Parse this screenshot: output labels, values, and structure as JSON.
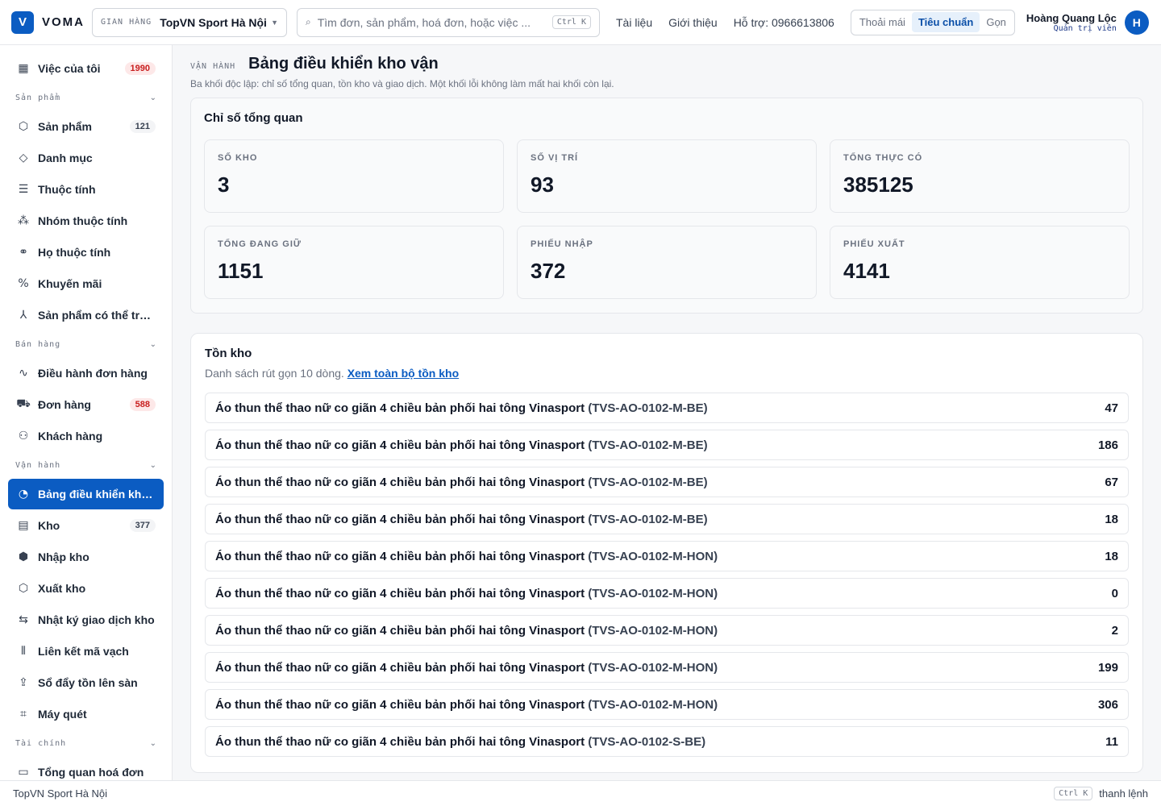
{
  "brand": {
    "logo_letter": "V",
    "name": "VOMA",
    "color": "#0b5cc2"
  },
  "store": {
    "prefix": "GIAN HÀNG",
    "name": "TopVN Sport Hà Nội"
  },
  "search": {
    "placeholder": "Tìm đơn, sản phẩm, hoá đơn, hoặc việc ...",
    "shortcut": "Ctrl K"
  },
  "top_links": [
    "Tài liệu",
    "Giới thiệu",
    "Hỗ trợ: 0966613806"
  ],
  "density": {
    "options": [
      "Thoải mái",
      "Tiêu chuẩn",
      "Gọn"
    ],
    "selected": "Tiêu chuẩn"
  },
  "user": {
    "name": "Hoàng Quang Lộc",
    "role": "Quản trị viên",
    "initial": "H"
  },
  "sidebar": {
    "top_item": {
      "label": "Việc của tôi",
      "badge": "1990",
      "icon": "grid-icon"
    },
    "sections": [
      {
        "label": "Sản phẩm",
        "items": [
          {
            "label": "Sản phẩm",
            "badge": "121",
            "icon": "box-icon"
          },
          {
            "label": "Danh mục",
            "icon": "tag-icon"
          },
          {
            "label": "Thuộc tính",
            "icon": "list-icon"
          },
          {
            "label": "Nhóm thuộc tính",
            "icon": "group-icon"
          },
          {
            "label": "Họ thuộc tính",
            "icon": "tree-icon"
          },
          {
            "label": "Khuyến mãi",
            "icon": "percent-icon"
          },
          {
            "label": "Sản phẩm có thể trùng",
            "icon": "merge-icon"
          }
        ]
      },
      {
        "label": "Bán hàng",
        "items": [
          {
            "label": "Điều hành đơn hàng",
            "icon": "activity-icon"
          },
          {
            "label": "Đơn hàng",
            "badge": "588",
            "badge_red": true,
            "icon": "cart-icon"
          },
          {
            "label": "Khách hàng",
            "icon": "users-icon"
          }
        ]
      },
      {
        "label": "Vận hành",
        "items": [
          {
            "label": "Bảng điều khiển kho vận",
            "active": true,
            "icon": "gauge-icon"
          },
          {
            "label": "Kho",
            "badge": "377",
            "icon": "warehouse-icon"
          },
          {
            "label": "Nhập kho",
            "icon": "box-in-icon"
          },
          {
            "label": "Xuất kho",
            "icon": "box-out-icon"
          },
          {
            "label": "Nhật ký giao dịch kho",
            "icon": "swap-icon"
          },
          {
            "label": "Liên kết mã vạch",
            "icon": "barcode-icon"
          },
          {
            "label": "Sổ đẩy tồn lên sàn",
            "icon": "upload-icon"
          },
          {
            "label": "Máy quét",
            "icon": "scanner-icon"
          }
        ]
      },
      {
        "label": "Tài chính",
        "items": [
          {
            "label": "Tổng quan hoá đơn",
            "icon": "invoice-icon"
          }
        ]
      }
    ]
  },
  "page": {
    "eyebrow": "VẬN HÀNH",
    "title": "Bảng điều khiển kho vận",
    "subtitle": "Ba khối độc lập: chỉ số tổng quan, tồn kho và giao dịch. Một khối lỗi không làm mất hai khối còn lại."
  },
  "kpi": {
    "title": "Chỉ số tổng quan",
    "items": [
      {
        "label": "SỐ KHO",
        "value": "3"
      },
      {
        "label": "SỐ VỊ TRÍ",
        "value": "93"
      },
      {
        "label": "TỔNG THỰC CÓ",
        "value": "385125"
      },
      {
        "label": "TỔNG ĐANG GIỮ",
        "value": "1151"
      },
      {
        "label": "PHIẾU NHẬP",
        "value": "372"
      },
      {
        "label": "PHIẾU XUẤT",
        "value": "4141"
      }
    ]
  },
  "stock": {
    "title": "Tồn kho",
    "subtitle": "Danh sách rút gọn 10 dòng.",
    "link": "Xem toàn bộ tồn kho",
    "rows": [
      {
        "name": "Áo thun thể thao nữ co giãn 4 chiều bản phối hai tông Vinasport",
        "sku": "(TVS-AO-0102-M-BE)",
        "qty": "47"
      },
      {
        "name": "Áo thun thể thao nữ co giãn 4 chiều bản phối hai tông Vinasport",
        "sku": "(TVS-AO-0102-M-BE)",
        "qty": "186"
      },
      {
        "name": "Áo thun thể thao nữ co giãn 4 chiều bản phối hai tông Vinasport",
        "sku": "(TVS-AO-0102-M-BE)",
        "qty": "67"
      },
      {
        "name": "Áo thun thể thao nữ co giãn 4 chiều bản phối hai tông Vinasport",
        "sku": "(TVS-AO-0102-M-BE)",
        "qty": "18"
      },
      {
        "name": "Áo thun thể thao nữ co giãn 4 chiều bản phối hai tông Vinasport",
        "sku": "(TVS-AO-0102-M-HON)",
        "qty": "18"
      },
      {
        "name": "Áo thun thể thao nữ co giãn 4 chiều bản phối hai tông Vinasport",
        "sku": "(TVS-AO-0102-M-HON)",
        "qty": "0"
      },
      {
        "name": "Áo thun thể thao nữ co giãn 4 chiều bản phối hai tông Vinasport",
        "sku": "(TVS-AO-0102-M-HON)",
        "qty": "2"
      },
      {
        "name": "Áo thun thể thao nữ co giãn 4 chiều bản phối hai tông Vinasport",
        "sku": "(TVS-AO-0102-M-HON)",
        "qty": "199"
      },
      {
        "name": "Áo thun thể thao nữ co giãn 4 chiều bản phối hai tông Vinasport",
        "sku": "(TVS-AO-0102-M-HON)",
        "qty": "306"
      },
      {
        "name": "Áo thun thể thao nữ co giãn 4 chiều bản phối hai tông Vinasport",
        "sku": "(TVS-AO-0102-S-BE)",
        "qty": "11"
      }
    ]
  },
  "footer": {
    "store": "TopVN Sport Hà Nội",
    "shortcut": "Ctrl K",
    "command_label": "thanh lệnh"
  }
}
